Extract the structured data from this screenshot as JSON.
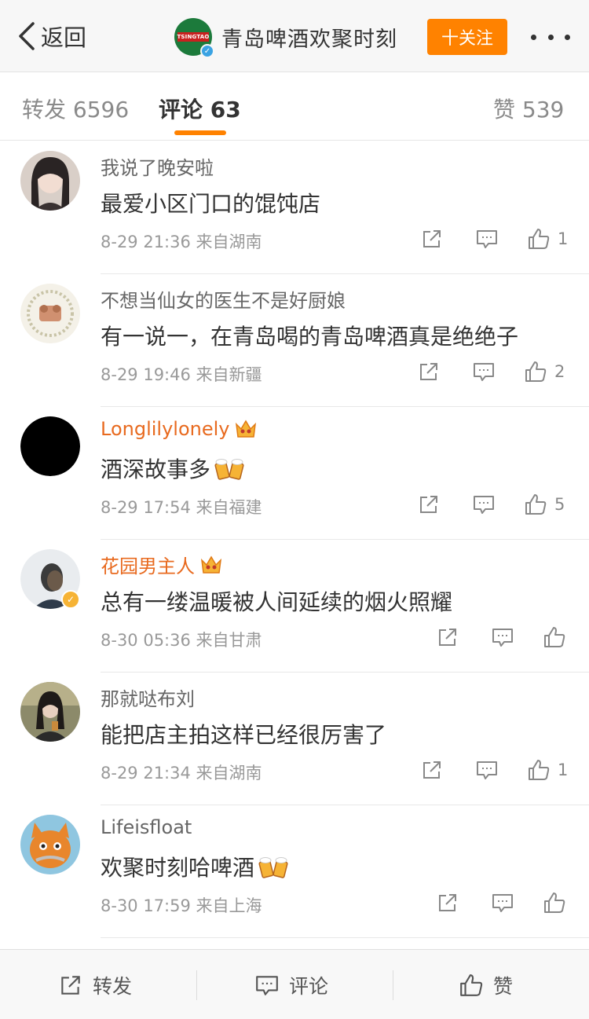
{
  "header": {
    "back_label": "返回",
    "title": "青岛啤酒欢聚时刻",
    "logo_text": "TSINGTAO",
    "follow_label": "十关注"
  },
  "tabs": {
    "repost": "转发 6596",
    "comments": "评论 63",
    "likes": "赞 539"
  },
  "comments": [
    {
      "user": "我说了晚安啦",
      "text": "最爱小区门口的馄饨店",
      "time": "8-29 21:36",
      "source": "来自湖南",
      "likes": "1"
    },
    {
      "user": "不想当仙女的医生不是好厨娘",
      "text": "有一说一，在青岛喝的青岛啤酒真是绝绝子",
      "time": "8-29 19:46",
      "source": "来自新疆",
      "likes": "2"
    },
    {
      "user": "Longlilylonely",
      "text": "酒深故事多",
      "time": "8-29 17:54",
      "source": "来自福建",
      "likes": "5"
    },
    {
      "user": "花园男主人",
      "text": "总有一缕温暖被人间延续的烟火照耀",
      "time": "8-30 05:36",
      "source": "来自甘肃",
      "likes": ""
    },
    {
      "user": "那就哒布刘",
      "text": "能把店主拍这样已经很厉害了",
      "time": "8-29 21:34",
      "source": "来自湖南",
      "likes": "1"
    },
    {
      "user": "Lifeisfloat",
      "text": "欢聚时刻哈啤酒",
      "time": "8-30 17:59",
      "source": "来自上海",
      "likes": ""
    }
  ],
  "bottom_bar": {
    "repost": "转发",
    "comment": "评论",
    "like": "赞"
  },
  "colors": {
    "accent": "#ff8200",
    "vip_name": "#e86a1f",
    "verified": "#3aa3e3"
  }
}
